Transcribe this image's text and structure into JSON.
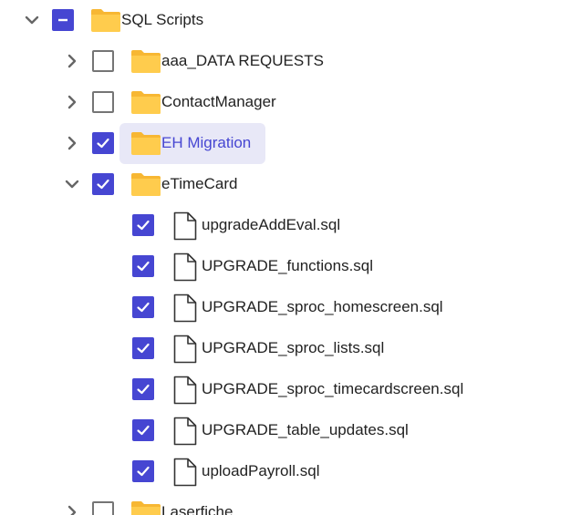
{
  "tree": {
    "colors": {
      "accent": "#4646d2",
      "folder": "#ffcc4d",
      "folder_tab": "#f7b733",
      "selected_bg": "#e8e8f7",
      "text": "#222222"
    },
    "root": {
      "label": "SQL Scripts",
      "expanded": true,
      "check_state": "indeterminate",
      "icon": "folder-icon"
    },
    "folders": [
      {
        "label": "aaa_DATA REQUESTS",
        "expanded": false,
        "check_state": "unchecked",
        "icon": "folder-icon"
      },
      {
        "label": "ContactManager",
        "expanded": false,
        "check_state": "unchecked",
        "icon": "folder-icon"
      },
      {
        "label": "EH Migration",
        "expanded": false,
        "check_state": "checked",
        "selected": true,
        "icon": "folder-icon"
      },
      {
        "label": "eTimeCard",
        "expanded": true,
        "check_state": "checked",
        "icon": "folder-icon"
      }
    ],
    "etimecard_files": [
      {
        "label": "upgradeAddEval.sql",
        "check_state": "checked",
        "icon": "file-icon"
      },
      {
        "label": "UPGRADE_functions.sql",
        "check_state": "checked",
        "icon": "file-icon"
      },
      {
        "label": "UPGRADE_sproc_homescreen.sql",
        "check_state": "checked",
        "icon": "file-icon"
      },
      {
        "label": "UPGRADE_sproc_lists.sql",
        "check_state": "checked",
        "icon": "file-icon"
      },
      {
        "label": "UPGRADE_sproc_timecardscreen.sql",
        "check_state": "checked",
        "icon": "file-icon"
      },
      {
        "label": "UPGRADE_table_updates.sql",
        "check_state": "checked",
        "icon": "file-icon"
      },
      {
        "label": "uploadPayroll.sql",
        "check_state": "checked",
        "icon": "file-icon"
      }
    ],
    "partial_folder": {
      "label": "Laserfiche",
      "expanded": false,
      "check_state": "unchecked",
      "icon": "folder-icon"
    }
  }
}
